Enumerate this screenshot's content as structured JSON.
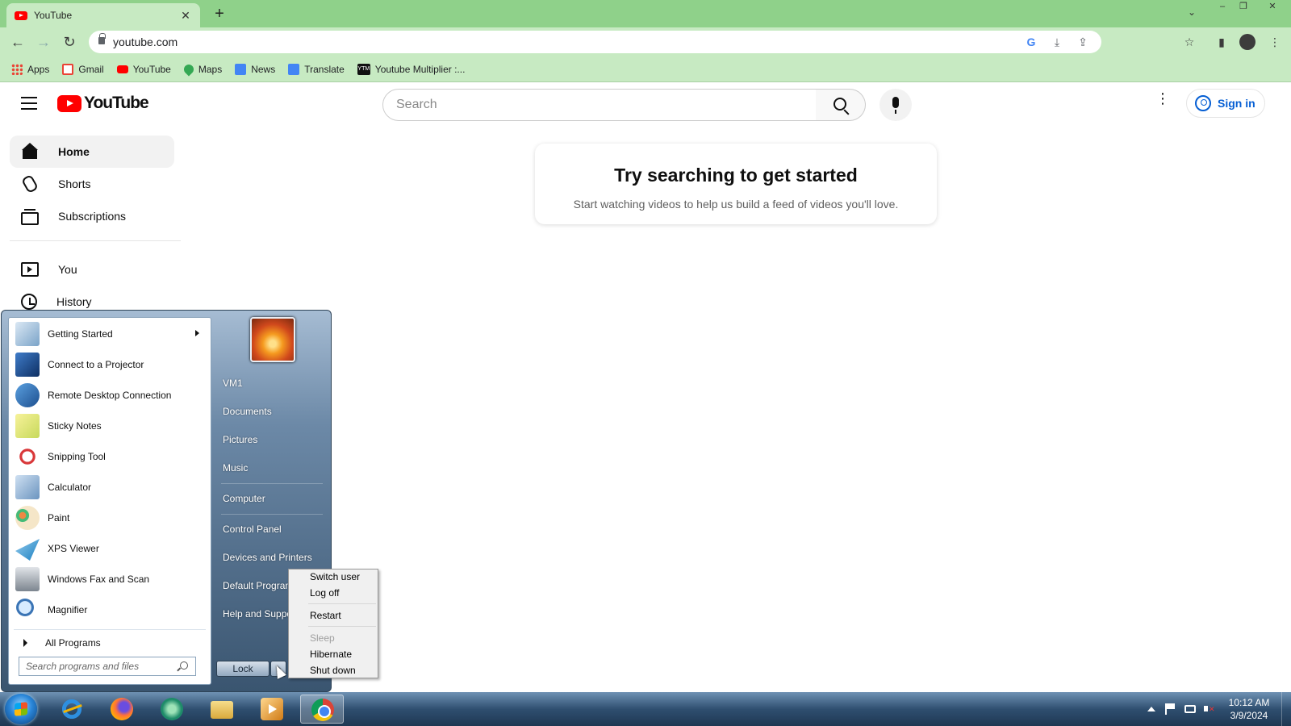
{
  "browser": {
    "tab_title": "YouTube",
    "tab_close": "✕",
    "new_tab": "+",
    "tab_list": "⌄",
    "window_controls": {
      "minimize": "–",
      "restore": "❐",
      "close": "✕"
    },
    "url": "youtube.com",
    "nav": {
      "back": "←",
      "forward": "→",
      "reload": "↻"
    },
    "omnibox_icons": {
      "google": "G",
      "install": "⤓",
      "share": "⇪",
      "bookmark": "☆"
    },
    "toolbar_icons": {
      "side_panel": "▮",
      "menu": "⋮"
    },
    "bookmarks": [
      {
        "label": "Apps",
        "icon": "apps-icon"
      },
      {
        "label": "Gmail",
        "icon": "gmail-icon"
      },
      {
        "label": "YouTube",
        "icon": "youtube-icon"
      },
      {
        "label": "Maps",
        "icon": "maps-icon"
      },
      {
        "label": "News",
        "icon": "news-icon"
      },
      {
        "label": "Translate",
        "icon": "translate-icon"
      },
      {
        "label": "Youtube Multiplier :...",
        "icon": "youtube-multiplier-icon",
        "icon_text": "YTM"
      }
    ]
  },
  "youtube": {
    "logo_text": "YouTube",
    "search_placeholder": "Search",
    "kebab": "⋮",
    "sign_in": "Sign in",
    "nav": [
      {
        "label": "Home",
        "icon": "home-icon",
        "active": true
      },
      {
        "label": "Shorts",
        "icon": "shorts-icon"
      },
      {
        "label": "Subscriptions",
        "icon": "subscriptions-icon"
      },
      {
        "label": "You",
        "icon": "you-icon"
      },
      {
        "label": "History",
        "icon": "history-icon"
      }
    ],
    "empty_state": {
      "title": "Try searching to get started",
      "subtitle": "Start watching videos to help us build a feed of videos you'll love."
    }
  },
  "start_menu": {
    "programs": [
      {
        "label": "Getting Started",
        "icon": "getting-started-icon",
        "has_submenu": true
      },
      {
        "label": "Connect to a Projector",
        "icon": "projector-icon"
      },
      {
        "label": "Remote Desktop Connection",
        "icon": "remote-desktop-icon"
      },
      {
        "label": "Sticky Notes",
        "icon": "sticky-notes-icon"
      },
      {
        "label": "Snipping Tool",
        "icon": "snipping-tool-icon"
      },
      {
        "label": "Calculator",
        "icon": "calculator-icon"
      },
      {
        "label": "Paint",
        "icon": "paint-icon"
      },
      {
        "label": "XPS Viewer",
        "icon": "xps-viewer-icon"
      },
      {
        "label": "Windows Fax and Scan",
        "icon": "fax-scan-icon"
      },
      {
        "label": "Magnifier",
        "icon": "magnifier-icon"
      }
    ],
    "all_programs": "All Programs",
    "search_placeholder": "Search programs and files",
    "right_links": [
      "VM1",
      "Documents",
      "Pictures",
      "Music",
      "Computer",
      "Control Panel",
      "Devices and Printers",
      "Default Programs",
      "Help and Support"
    ],
    "lock_label": "Lock",
    "power_menu": [
      {
        "label": "Switch user",
        "enabled": true
      },
      {
        "label": "Log off",
        "enabled": true
      },
      {
        "label": "Restart",
        "enabled": true
      },
      {
        "label": "Sleep",
        "enabled": false
      },
      {
        "label": "Hibernate",
        "enabled": true
      },
      {
        "label": "Shut down",
        "enabled": true
      }
    ]
  },
  "taskbar": {
    "apps": [
      "internet-explorer-icon",
      "firefox-icon",
      "vpn-icon",
      "file-explorer-icon",
      "media-player-icon",
      "chrome-icon"
    ],
    "active_app": "chrome-icon",
    "clock_time": "10:12 AM",
    "clock_date": "3/9/2024"
  }
}
